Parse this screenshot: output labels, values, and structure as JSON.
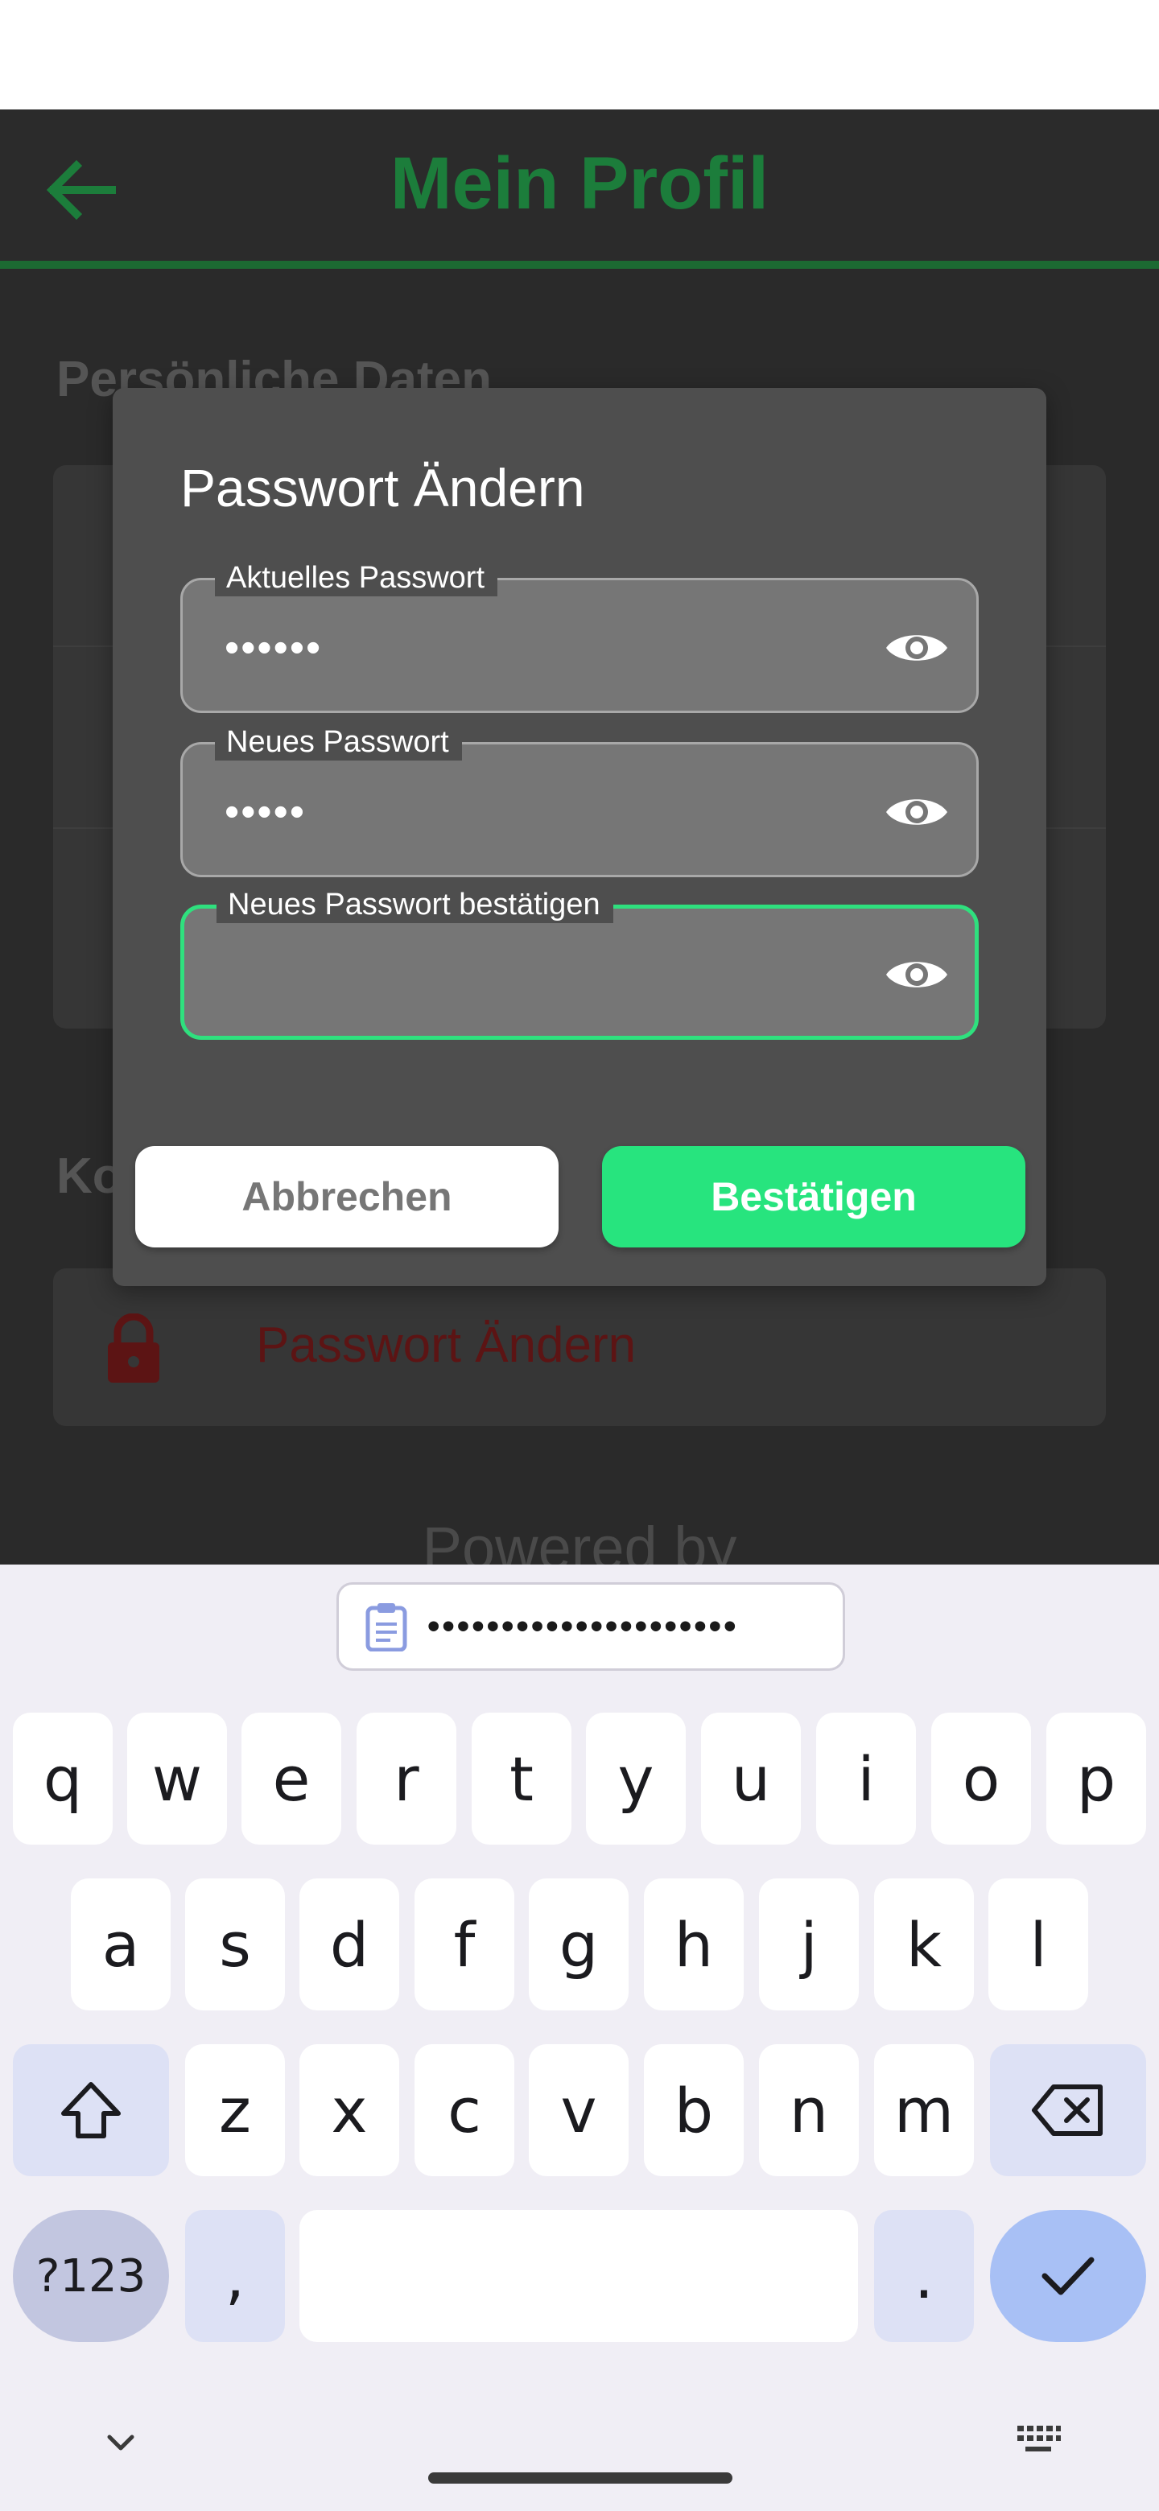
{
  "app": {
    "title": "Mein Profil",
    "section_personal": "Persönliche Daten",
    "section_account": "Ko",
    "account_row_label": "Passwort Ändern",
    "powered_by": "Powered by"
  },
  "dialog": {
    "title": "Passwort Ändern",
    "fields": [
      {
        "label": "Aktuelles Passwort",
        "value": "••••••",
        "focused": false
      },
      {
        "label": "Neues Passwort",
        "value": "•••••",
        "focused": false
      },
      {
        "label": "Neues Passwort bestätigen",
        "value": "",
        "focused": true
      }
    ],
    "cancel_label": "Abbrechen",
    "confirm_label": "Bestätigen"
  },
  "keyboard": {
    "clipboard_text": "•••••••••••••••••••••",
    "row1": [
      "q",
      "w",
      "e",
      "r",
      "t",
      "y",
      "u",
      "i",
      "o",
      "p"
    ],
    "row2": [
      "a",
      "s",
      "d",
      "f",
      "g",
      "h",
      "j",
      "k",
      "l"
    ],
    "row3": [
      "z",
      "x",
      "c",
      "v",
      "b",
      "n",
      "m"
    ],
    "symbols_label": "?123",
    "comma_label": ",",
    "period_label": "."
  },
  "colors": {
    "accent_green": "#27e47e",
    "title_green": "#1c7d3b",
    "dialog_bg": "#4e4e4e"
  },
  "icons": {
    "back": "arrow-left-icon",
    "eye": "eye-icon",
    "lock": "lock-icon",
    "clipboard": "clipboard-icon",
    "shift": "shift-icon",
    "backspace": "backspace-icon",
    "enter": "check-icon",
    "hide_keyboard": "chevron-down-icon",
    "keyboard_switch": "keyboard-icon"
  }
}
